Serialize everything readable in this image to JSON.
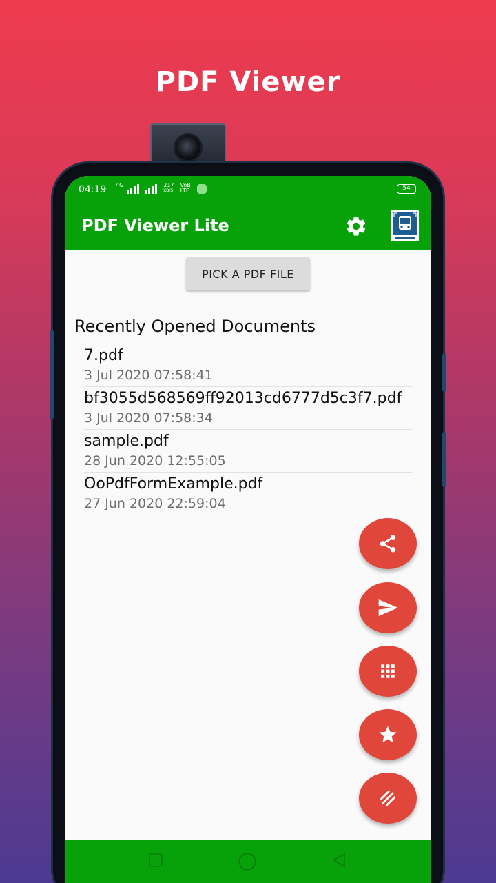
{
  "promo": {
    "title": "PDF Viewer"
  },
  "statusbar": {
    "time": "04:19",
    "net_small_1": "4G",
    "net_speed_top": "217",
    "net_speed_bottom": "KB/S",
    "volte_top": "VoB",
    "volte_bottom": "LTE",
    "battery": "54"
  },
  "appbar": {
    "title": "PDF Viewer Lite",
    "settings_icon": "gear-icon",
    "logo_icon": "app-logo-icon"
  },
  "main": {
    "pick_button": "PICK A PDF FILE",
    "section_title": "Recently Opened Documents",
    "documents": [
      {
        "name": "7.pdf",
        "date": "3 Jul 2020 07:58:41"
      },
      {
        "name": "bf3055d568569ff92013cd6777d5c3f7.pdf",
        "date": "3 Jul 2020 07:58:34"
      },
      {
        "name": "sample.pdf",
        "date": "28 Jun 2020 12:55:05"
      },
      {
        "name": "OoPdfFormExample.pdf",
        "date": "27 Jun 2020 22:59:04"
      }
    ]
  },
  "fabs": [
    {
      "icon": "share-icon"
    },
    {
      "icon": "send-icon"
    },
    {
      "icon": "apps-grid-icon"
    },
    {
      "icon": "star-icon"
    },
    {
      "icon": "menu-lines-icon"
    }
  ],
  "colors": {
    "appbar": "#07a10a",
    "fab": "#e0463a",
    "gradient_top": "#ee3b4d",
    "gradient_bottom": "#4c3a92"
  }
}
